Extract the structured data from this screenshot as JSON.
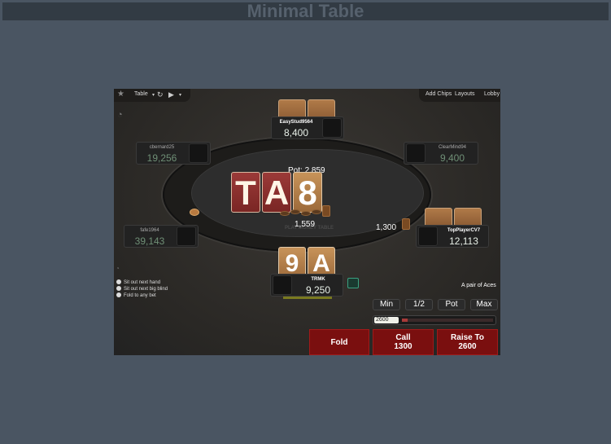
{
  "window": {
    "title": "Minimal Table"
  },
  "toolbar": {
    "table_label": "Table",
    "add_chips": "Add Chips",
    "layouts": "Layouts",
    "lobby": "Lobby"
  },
  "table": {
    "watermark": "PLAY MONEY TABLE",
    "pot_label": "Pot: 2,859",
    "board": [
      "T",
      "A",
      "8"
    ],
    "center_bet": "1,559",
    "right_bet": "1,300"
  },
  "players": {
    "top": {
      "name": "EasyStud9564",
      "stack": "8,400"
    },
    "upper_left": {
      "name": "cbernard25",
      "stack": "19,256"
    },
    "upper_right": {
      "name": "ClearMind94",
      "stack": "9,400"
    },
    "left": {
      "name": "fafe1964",
      "stack": "39,143"
    },
    "right": {
      "name": "TopPlayerCV7",
      "stack": "12,113"
    },
    "hero": {
      "name": "TRMK",
      "stack": "9,250",
      "cards": [
        "9",
        "A"
      ],
      "hand_description": "A pair of Aces"
    }
  },
  "options": {
    "sit_out_next_hand": "Sit out next hand",
    "sit_out_big_blind": "Sit out next big blind",
    "fold_to_any_bet": "Fold to any bet"
  },
  "bet_sizing": {
    "min": "Min",
    "half": "1/2",
    "pot": "Pot",
    "max": "Max",
    "amount": "2600",
    "slider_fraction": 0.06
  },
  "actions": {
    "fold": "Fold",
    "call_label": "Call",
    "call_amount": "1300",
    "raise_label": "Raise To",
    "raise_amount": "2600"
  },
  "colors": {
    "action_button": "#7a0f0f",
    "active_stack": "#e8f0e8",
    "inactive_stack": "#6f8f76"
  }
}
